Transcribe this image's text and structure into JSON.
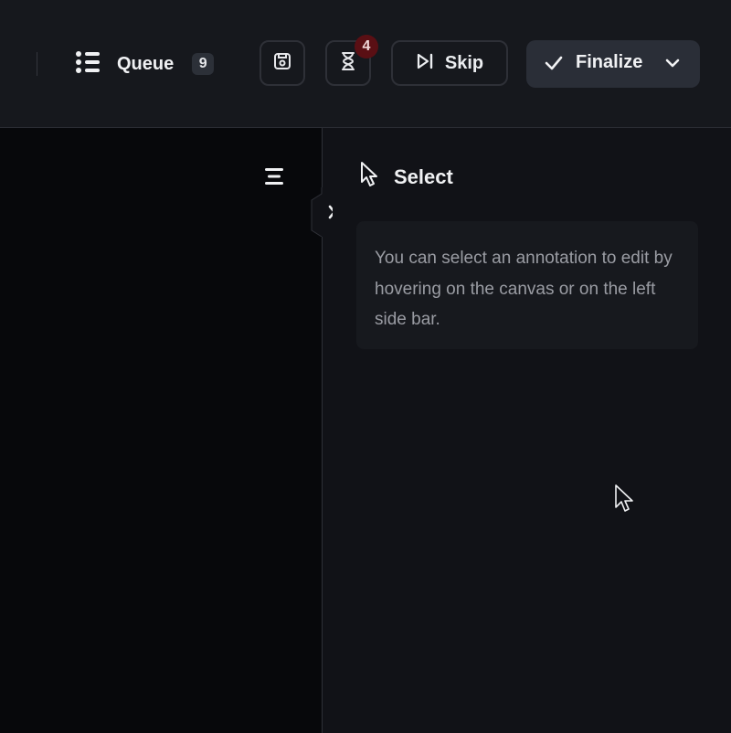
{
  "toolbar": {
    "queue_label": "Queue",
    "queue_count": "9",
    "timer_badge": "4",
    "skip_label": "Skip",
    "finalize_label": "Finalize"
  },
  "icons": {
    "queue": "list-icon",
    "save": "save-icon",
    "timer": "hourglass-icon",
    "skip": "skip-forward-icon",
    "finalize": "check-icon",
    "finalize_menu": "chevron-down-icon",
    "sidebar_toggle": "hamburger-icon",
    "collapse": "chevron-right-icon",
    "select_tool": "pointer-icon"
  },
  "panel": {
    "title": "Select",
    "hint": "You can select an annotation to edit by hovering on the canvas or on the left side bar."
  },
  "colors": {
    "background": "#111217",
    "canvas": "#07080b",
    "button_border": "#2e3037",
    "finalize_bg": "#2a2e37",
    "badge_bg": "#5a0f14",
    "hint_text": "#9a9ca3"
  }
}
